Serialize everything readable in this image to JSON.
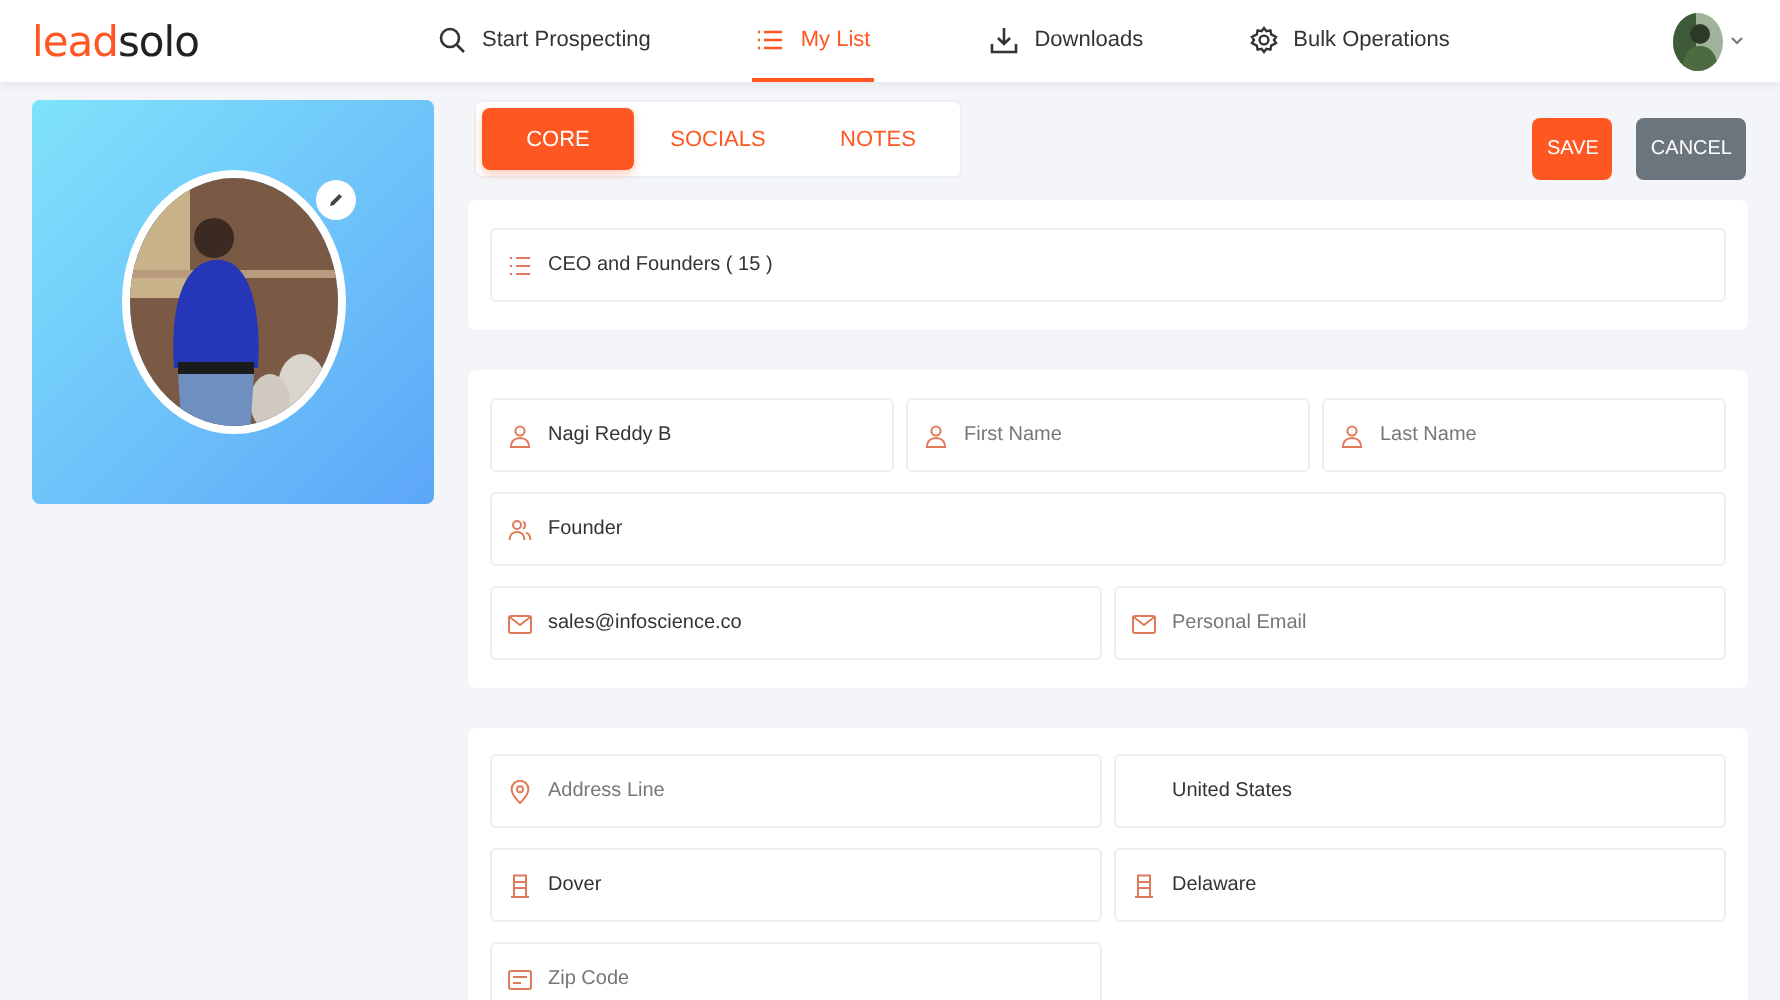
{
  "header": {
    "logo": {
      "lead": "lead",
      "solo": "solo"
    },
    "nav": [
      {
        "label": "Start Prospecting",
        "kind": "search",
        "selected": false
      },
      {
        "label": "My List",
        "kind": "list",
        "selected": true
      },
      {
        "label": "Downloads",
        "kind": "download",
        "selected": false
      },
      {
        "label": "Bulk Operations",
        "kind": "gear",
        "selected": false
      }
    ]
  },
  "tabs": [
    {
      "label": "CORE",
      "selected": true
    },
    {
      "label": "SOCIALS",
      "selected": false
    },
    {
      "label": "NOTES",
      "selected": false
    }
  ],
  "actions": [
    {
      "label": "SAVE",
      "kind": "primary"
    },
    {
      "label": "CANCEL",
      "kind": "secondary"
    }
  ],
  "sections": [
    {
      "rows": [
        [
          {
            "kind": "list",
            "value": "CEO and Founders ( 15 )"
          }
        ]
      ]
    },
    {
      "rows": [
        [
          {
            "kind": "person",
            "value": "Nagi Reddy B"
          },
          {
            "kind": "person",
            "placeholder": "First Name"
          },
          {
            "kind": "person",
            "placeholder": "Last Name"
          }
        ],
        [
          {
            "kind": "title",
            "value": "Founder"
          }
        ],
        [
          {
            "kind": "email",
            "value": "sales@infoscience.co"
          },
          {
            "kind": "email",
            "placeholder": "Personal Email"
          }
        ]
      ]
    },
    {
      "rows": [
        [
          {
            "kind": "address",
            "placeholder": "Address Line"
          },
          {
            "kind": "select",
            "value": "United States"
          }
        ],
        [
          {
            "kind": "city",
            "value": "Dover"
          },
          {
            "kind": "city",
            "value": "Delaware"
          }
        ],
        [
          {
            "kind": "zip",
            "placeholder": "Zip Code"
          },
          {
            "kind": "spacer"
          }
        ]
      ]
    }
  ]
}
